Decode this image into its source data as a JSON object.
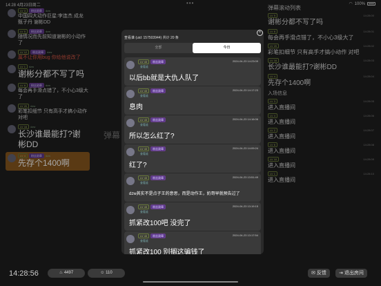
{
  "status": {
    "time": "14:28",
    "date": "4月23日周二",
    "wifi": "wifi",
    "battery": "100%"
  },
  "left_feed": [
    {
      "tag": "LV 3",
      "tag2": "粉丝勋章",
      "user": "dzw",
      "text": "中国四大动作巨星:李连杰 成龙 甄子丹 谢彬DD",
      "style": "normal"
    },
    {
      "tag": "LV 5",
      "tag2": "粉丝勋章",
      "user": "dzw",
      "text": "随情况而先前知道谢彬的小动作了",
      "style": "normal"
    },
    {
      "tag": "LV 12",
      "tag2": "粉丝勋章",
      "user": "dzw",
      "text": "属不让你用bug 你给他说改了",
      "style": "red"
    },
    {
      "tag": "LV 1",
      "tag2": "",
      "user": "dzw",
      "text": "谢彬分都不写了吗",
      "style": "big"
    },
    {
      "tag": "LV 8",
      "tag2": "粉丝勋章",
      "user": "dzw",
      "text": "每会再手滑点错了，不小心3级大了",
      "style": "normal"
    },
    {
      "tag": "LV 20",
      "tag2": "",
      "user": "dzw",
      "text": "彩笔扣细节 只有高手才搞小动作 对吧",
      "style": "normal"
    },
    {
      "tag": "LV 16",
      "tag2": "",
      "user": "dzw",
      "text": "长沙谁最能打?谢彬DD",
      "style": "big"
    },
    {
      "tag": "LV 4",
      "tag2": "粉丝勋章",
      "user": "dzw",
      "text": "先存个1400啊",
      "style": "hl"
    }
  ],
  "center_bg_text": "弹幕",
  "right_panel": {
    "title": "弹幕滚动列表",
    "items": [
      {
        "tag": "LV 5",
        "time": "14:28:00",
        "text": "谢彬分都不写了吗",
        "big": true
      },
      {
        "tag": "LV 8",
        "time": "14:28:01",
        "text": "每会再手滑点错了，不小心3级大了",
        "big": false
      },
      {
        "tag": "LV 20",
        "time": "14:28:02",
        "text": "彩笔扣细节 只有高手才搞小动作 对吧",
        "big": false
      },
      {
        "tag": "LV 16",
        "time": "14:28:03",
        "text": "长沙谁最能打?谢彬DD",
        "big": true
      },
      {
        "tag": "LV 4",
        "time": "14:28:04",
        "text": "先存个1400啊",
        "big": true
      }
    ],
    "entry_title": "入场信息",
    "entries": [
      {
        "tag": "LV 3",
        "time": "14:28:05",
        "text": "进入直播间"
      },
      {
        "tag": "LV 4",
        "time": "14:28:06",
        "text": "进入直播间"
      },
      {
        "tag": "LV 2",
        "time": "14:28:07",
        "text": "进入直播间"
      },
      {
        "tag": "LV 6",
        "time": "14:28:08",
        "text": "进入直播间"
      },
      {
        "tag": "LV 10",
        "time": "14:28:09",
        "text": "进入直播间"
      },
      {
        "tag": "LV 1",
        "time": "14:28:10",
        "text": "进入直播间"
      }
    ]
  },
  "modal": {
    "title": "查看谁 (uid: 157503944) 共计 20 条",
    "close": "×",
    "tabs": [
      {
        "label": "全部",
        "active": false
      },
      {
        "label": "今日",
        "active": true
      }
    ],
    "messages": [
      {
        "lv": "LV 43",
        "badge": "粉丝勋章",
        "sub": "查看谁",
        "time": "2024-04-23 14:23:09",
        "text": "以后bb就是大仇人队了",
        "small": false
      },
      {
        "lv": "LV 43",
        "badge": "粉丝勋章",
        "sub": "查看谁",
        "time": "2024-04-23 14:17:23",
        "text": "息肉",
        "small": false
      },
      {
        "lv": "LV 43",
        "badge": "粉丝勋章",
        "sub": "查看谁",
        "time": "2024-04-23 14:16:06",
        "text": "所以怎么红了?",
        "small": false
      },
      {
        "lv": "LV 43",
        "badge": "粉丝勋章",
        "sub": "查看谁",
        "time": "2024-04-23 14:09:24",
        "text": "红了?",
        "small": false
      },
      {
        "lv": "LV 43",
        "badge": "粉丝勋章",
        "sub": "查看谁",
        "time": "2024-04-23 13:51:49",
        "text": "dzw其实不是点子王的意思，而是动作王，奶哥早就预告过了",
        "small": true
      },
      {
        "lv": "LV 43",
        "badge": "粉丝勋章",
        "sub": "查看谁",
        "time": "2024-04-23 13:19:15",
        "text": "抓紧改100吧 没完了",
        "small": false
      },
      {
        "lv": "LV 43",
        "badge": "粉丝勋章",
        "sub": "查看谁",
        "time": "2024-04-23 13:17:54",
        "text": "抓紧改100 别搁这骗钱了",
        "small": false
      }
    ]
  },
  "bottom": {
    "clock": "14:28:56",
    "likes": "4497",
    "viewers": "110",
    "feedback": "反馈",
    "exit": "退出房间"
  }
}
